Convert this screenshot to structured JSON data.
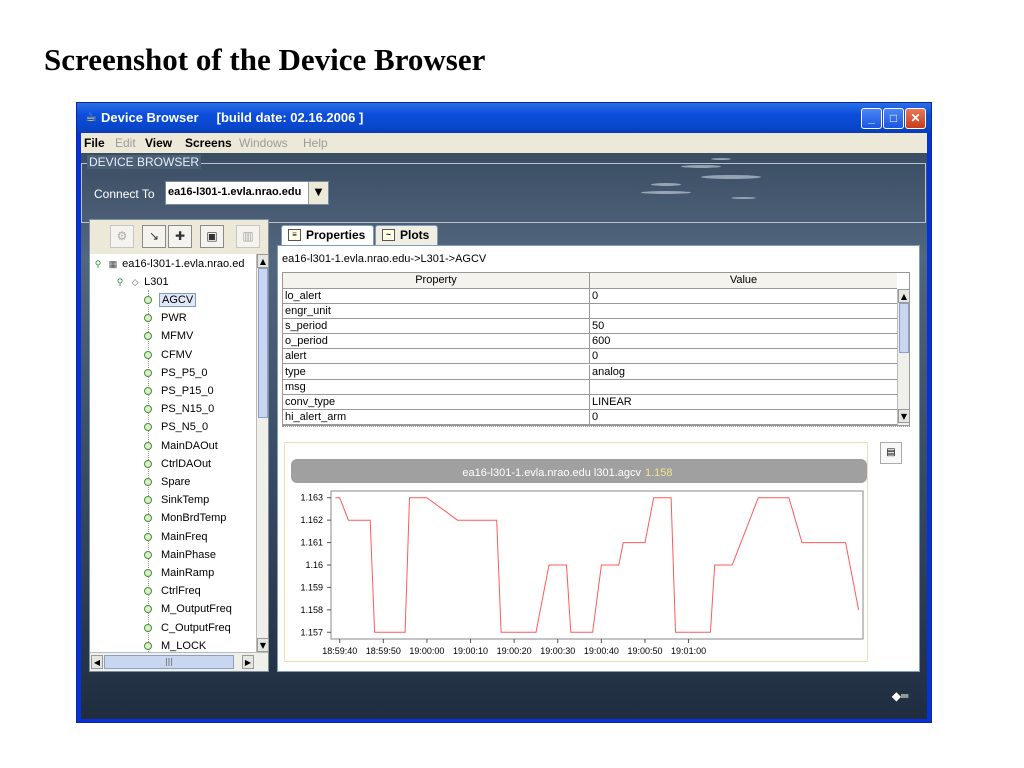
{
  "slide": {
    "title": "Screenshot of the Device Browser"
  },
  "window": {
    "title": "Device Browser     [build date: 02.16.2006 ]",
    "controls": {
      "minimize": "_",
      "maximize": "□",
      "close": "✕"
    }
  },
  "menu": [
    {
      "label": "File",
      "enabled": true
    },
    {
      "label": "Edit",
      "enabled": false
    },
    {
      "label": "View",
      "enabled": true
    },
    {
      "label": "Screens",
      "enabled": true
    },
    {
      "label": "Windows",
      "enabled": false
    },
    {
      "label": "Help",
      "enabled": false
    }
  ],
  "device_browser": {
    "legend": "DEVICE BROWSER",
    "connect_label": "Connect To",
    "connect_value": "ea16-l301-1.evla.nrao.edu"
  },
  "tree": {
    "root": "ea16-l301-1.evla.nrao.ed",
    "module": "L301",
    "selected": "AGCV",
    "items": [
      "AGCV",
      "PWR",
      "MFMV",
      "CFMV",
      "PS_P5_0",
      "PS_P15_0",
      "PS_N15_0",
      "PS_N5_0",
      "MainDAOut",
      "CtrlDAOut",
      "Spare",
      "SinkTemp",
      "MonBrdTemp",
      "MainFreq",
      "MainPhase",
      "MainRamp",
      "CtrlFreq",
      "M_OutputFreq",
      "C_OutputFreq",
      "M_LOCK"
    ]
  },
  "tabs": [
    {
      "label": "Properties",
      "active": true
    },
    {
      "label": "Plots",
      "active": false
    }
  ],
  "breadcrumb": "ea16-l301-1.evla.nrao.edu->L301->AGCV",
  "properties": {
    "headers": [
      "Property",
      "Value"
    ],
    "rows": [
      {
        "key": "lo_alert",
        "value": "0"
      },
      {
        "key": "engr_unit",
        "value": ""
      },
      {
        "key": "s_period",
        "value": "50"
      },
      {
        "key": "o_period",
        "value": "600"
      },
      {
        "key": "alert",
        "value": "0"
      },
      {
        "key": "type",
        "value": "analog"
      },
      {
        "key": "msg",
        "value": ""
      },
      {
        "key": "conv_type",
        "value": "LINEAR"
      },
      {
        "key": "hi_alert_arm",
        "value": "0"
      }
    ]
  },
  "chart_data": {
    "type": "line",
    "title": "ea16-l301-1.evla.nrao.edu l301.agcv",
    "title_value": "1.158",
    "colors": {
      "line": "#ff5a5a",
      "header_bg": "#a0a0a0",
      "title_value": "#f0e68c"
    },
    "x_ticks": [
      "18:59:40",
      "18:59:50",
      "19:00:00",
      "19:00:10",
      "19:00:20",
      "19:00:30",
      "19:00:40",
      "19:00:50",
      "19:01:00"
    ],
    "x_range_seconds": [
      -42,
      80
    ],
    "y_ticks": [
      1.157,
      1.158,
      1.159,
      1.16,
      1.161,
      1.162,
      1.163
    ],
    "ylim": [
      1.1567,
      1.1633
    ],
    "grid": false,
    "series": [
      {
        "x": [
          -41,
          -40,
          -38,
          -36,
          -33,
          -32,
          -29,
          -28,
          -25,
          -24,
          -21,
          -20,
          -13,
          -12,
          -8,
          -7,
          -4,
          -3,
          4,
          5,
          8,
          9,
          12,
          13,
          17,
          18,
          20,
          21,
          24,
          25,
          29,
          30,
          32,
          33,
          36,
          37,
          41,
          42,
          45,
          46,
          49,
          50,
          56,
          57,
          59,
          60,
          62,
          63,
          66,
          67,
          70,
          71,
          75,
          76,
          79
        ],
        "y": [
          1.163,
          1.163,
          1.162,
          1.162,
          1.162,
          1.157,
          1.157,
          1.157,
          1.157,
          1.163,
          1.163,
          1.163,
          1.162,
          1.162,
          1.162,
          1.162,
          1.162,
          1.157,
          1.157,
          1.157,
          1.16,
          1.16,
          1.16,
          1.157,
          1.157,
          1.157,
          1.16,
          1.16,
          1.16,
          1.161,
          1.161,
          1.161,
          1.163,
          1.163,
          1.163,
          1.157,
          1.157,
          1.157,
          1.157,
          1.16,
          1.16,
          1.16,
          1.163,
          1.163,
          1.163,
          1.163,
          1.163,
          1.163,
          1.161,
          1.161,
          1.161,
          1.161,
          1.161,
          1.161,
          1.158
        ]
      }
    ]
  },
  "icons": {
    "window": "java-cup-icon",
    "toolbar": [
      "gear-icon",
      "collapse-icon",
      "expand-icon",
      "monitor-icon",
      "trash-icon"
    ],
    "chart_options": "chart-options-icon"
  }
}
